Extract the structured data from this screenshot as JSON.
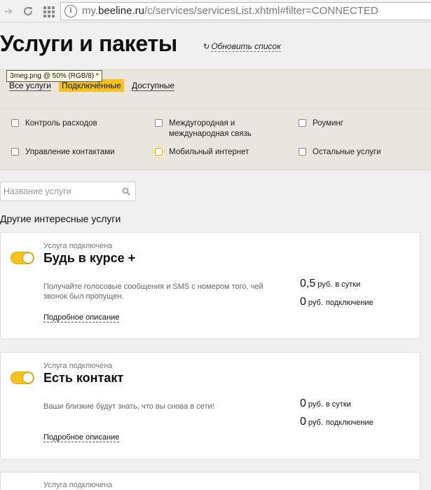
{
  "browser": {
    "url_prefix": "my.",
    "url_host": "beeline.ru",
    "url_path": "/c/services/servicesList.xhtml#filter=CONNECTED"
  },
  "header": {
    "title": "Услуги и пакеты",
    "refresh_label": "Обновить список"
  },
  "tooltip": "Зmeg.png @ 50% (RGB/8) *",
  "tabs": [
    {
      "label": "Все услуги",
      "active": false
    },
    {
      "label": "Подключённые",
      "active": true
    },
    {
      "label": "Доступные",
      "active": false
    }
  ],
  "categories": [
    {
      "label": "Контроль расходов"
    },
    {
      "label": "Междугородная и международная связь"
    },
    {
      "label": "Роуминг"
    },
    {
      "label": "Управление контактами"
    },
    {
      "label": "Мобильный интернет"
    },
    {
      "label": "Остальные услуги"
    }
  ],
  "search": {
    "placeholder": "Название услуги"
  },
  "section_title": "Другие интересные услуги",
  "services": [
    {
      "status": "Услуга подключена",
      "name": "Будь в курсе +",
      "description": "Получайте голосовые сообщения и SMS с номером того, чей звонок был пропущен.",
      "more": "Подробное описание",
      "prices": [
        {
          "value": "0,5",
          "currency": "руб.",
          "period": "в сутки"
        },
        {
          "value": "0",
          "currency": "руб.",
          "period": "подключение"
        }
      ]
    },
    {
      "status": "Услуга подключена",
      "name": "Есть контакт",
      "description": "Ваши близкие будут знать, что вы снова в сети!",
      "more": "Подробное описание",
      "prices": [
        {
          "value": "0",
          "currency": "руб.",
          "period": "в сутки"
        },
        {
          "value": "0",
          "currency": "руб.",
          "period": "подключение"
        }
      ]
    },
    {
      "status": "Услуга подключена"
    }
  ],
  "colors": {
    "accent": "#f6c21c",
    "filter_bg": "#e9e5df",
    "page_bg": "#f0f0f0"
  }
}
